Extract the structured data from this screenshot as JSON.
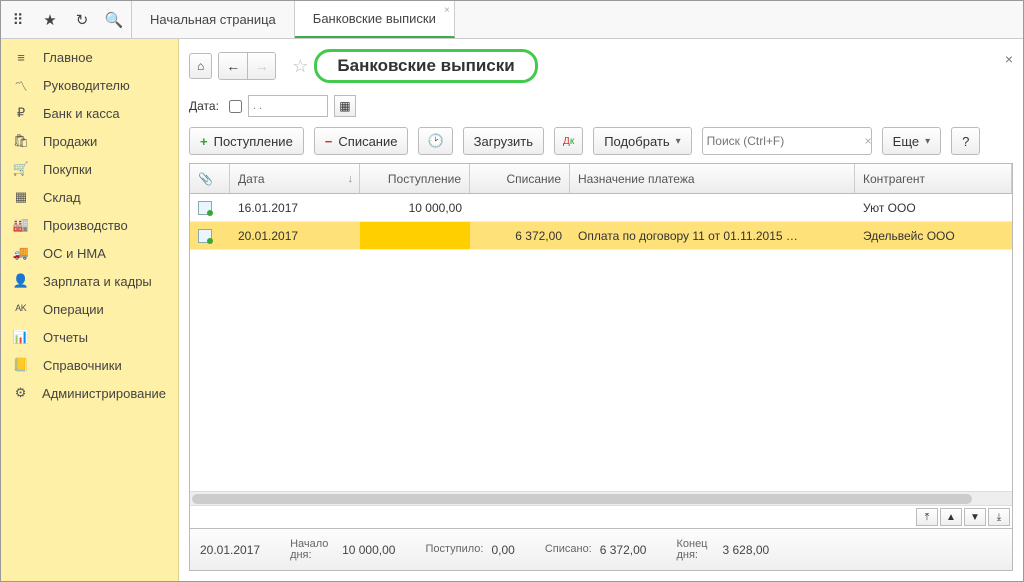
{
  "tabs": [
    {
      "label": "Начальная страница"
    },
    {
      "label": "Банковские выписки"
    }
  ],
  "sidebar": [
    {
      "label": "Главное",
      "icon": "≡"
    },
    {
      "label": "Руководителю",
      "icon": "〽"
    },
    {
      "label": "Банк и касса",
      "icon": "₽"
    },
    {
      "label": "Продажи",
      "icon": "🛍"
    },
    {
      "label": "Покупки",
      "icon": "🛒"
    },
    {
      "label": "Склад",
      "icon": "▦"
    },
    {
      "label": "Производство",
      "icon": "🏭"
    },
    {
      "label": "ОС и НМА",
      "icon": "🚚"
    },
    {
      "label": "Зарплата и кадры",
      "icon": "👤"
    },
    {
      "label": "Операции",
      "icon": "ᴬᴷ"
    },
    {
      "label": "Отчеты",
      "icon": "📊"
    },
    {
      "label": "Справочники",
      "icon": "📒"
    },
    {
      "label": "Администрирование",
      "icon": "⚙"
    }
  ],
  "page": {
    "title": "Банковские выписки"
  },
  "filter": {
    "date_label": "Дата:",
    "date_placeholder": ". ."
  },
  "toolbar": {
    "incoming": "Поступление",
    "outgoing": "Списание",
    "load": "Загрузить",
    "pick": "Подобрать",
    "search_placeholder": "Поиск (Ctrl+F)",
    "more": "Еще",
    "help": "?"
  },
  "columns": {
    "attach": "📎",
    "date": "Дата",
    "in": "Поступление",
    "out": "Списание",
    "desc": "Назначение платежа",
    "contr": "Контрагент"
  },
  "rows": [
    {
      "date": "16.01.2017",
      "in": "10 000,00",
      "out": "",
      "desc": "",
      "contr": "Уют ООО",
      "selected": false
    },
    {
      "date": "20.01.2017",
      "in": "",
      "out": "6 372,00",
      "desc": "Оплата по договору 11 от 01.11.2015 …",
      "contr": "Эдельвейс ООО",
      "selected": true
    }
  ],
  "status": {
    "date": "20.01.2017",
    "begin_label": "Начало дня:",
    "begin_value": "10 000,00",
    "in_label": "Поступило:",
    "in_value": "0,00",
    "out_label": "Списано:",
    "out_value": "6 372,00",
    "end_label": "Конец дня:",
    "end_value": "3 628,00"
  }
}
